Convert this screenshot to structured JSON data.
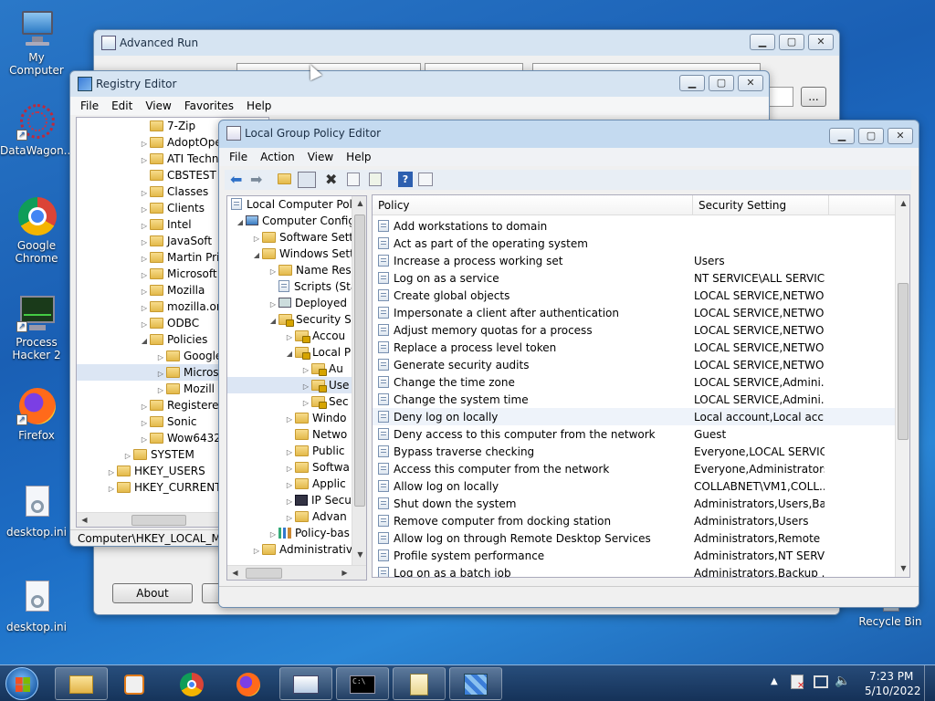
{
  "desktop": {
    "icons": [
      {
        "label": "My Computer"
      },
      {
        "label": "DataWagon..."
      },
      {
        "label": "Google Chrome"
      },
      {
        "label": "Process Hacker 2"
      },
      {
        "label": "Firefox"
      },
      {
        "label": "desktop.ini"
      },
      {
        "label": "desktop.ini"
      },
      {
        "label": "Recycle Bin"
      }
    ]
  },
  "advanced_run": {
    "title": "Advanced Run",
    "about_button": "About",
    "browse_button": "..."
  },
  "registry": {
    "title": "Registry Editor",
    "menu": [
      "File",
      "Edit",
      "View",
      "Favorites",
      "Help"
    ],
    "tree": [
      "7-Zip",
      "AdoptOpe",
      "ATI Techn",
      "CBSTEST",
      "Classes",
      "Clients",
      "Intel",
      "JavaSoft",
      "Martin Pri",
      "Microsoft",
      "Mozilla",
      "mozilla.or",
      "ODBC",
      "Policies",
      "Google",
      "Micros",
      "Mozill",
      "Registered",
      "Sonic",
      "Wow6432N",
      "SYSTEM",
      "HKEY_USERS",
      "HKEY_CURRENT_"
    ],
    "status": "Computer\\HKEY_LOCAL_MA"
  },
  "gpedit": {
    "title": "Local Group Policy Editor",
    "menu": [
      "File",
      "Action",
      "View",
      "Help"
    ],
    "tree": [
      "Local Computer Polic",
      "Computer Config",
      "Software Setti",
      "Windows Sett",
      "Name Res",
      "Scripts (Sta",
      "Deployed",
      "Security Se",
      "Accou",
      "Local P",
      "Au",
      "Use",
      "Sec",
      "Windo",
      "Netwo",
      "Public",
      "Softwa",
      "Applic",
      "IP Secu",
      "Advan",
      "Policy-bas",
      "Administrative"
    ],
    "columns": {
      "policy": "Policy",
      "setting": "Security Setting"
    },
    "rows": [
      {
        "policy": "Add workstations to domain",
        "setting": ""
      },
      {
        "policy": "Act as part of the operating system",
        "setting": ""
      },
      {
        "policy": "Increase a process working set",
        "setting": "Users"
      },
      {
        "policy": "Log on as a service",
        "setting": "NT SERVICE\\ALL SERVIC..."
      },
      {
        "policy": "Create global objects",
        "setting": "LOCAL SERVICE,NETWO..."
      },
      {
        "policy": "Impersonate a client after authentication",
        "setting": "LOCAL SERVICE,NETWO..."
      },
      {
        "policy": "Adjust memory quotas for a process",
        "setting": "LOCAL SERVICE,NETWO..."
      },
      {
        "policy": "Replace a process level token",
        "setting": "LOCAL SERVICE,NETWO..."
      },
      {
        "policy": "Generate security audits",
        "setting": "LOCAL SERVICE,NETWO..."
      },
      {
        "policy": "Change the time zone",
        "setting": "LOCAL SERVICE,Admini..."
      },
      {
        "policy": "Change the system time",
        "setting": "LOCAL SERVICE,Admini..."
      },
      {
        "policy": "Deny log on locally",
        "setting": "Local account,Local acc..."
      },
      {
        "policy": "Deny access to this computer from the network",
        "setting": "Guest"
      },
      {
        "policy": "Bypass traverse checking",
        "setting": "Everyone,LOCAL SERVIC..."
      },
      {
        "policy": "Access this computer from the network",
        "setting": "Everyone,Administrators..."
      },
      {
        "policy": "Allow log on locally",
        "setting": "COLLABNET\\VM1,COLL..."
      },
      {
        "policy": "Shut down the system",
        "setting": "Administrators,Users,Ba..."
      },
      {
        "policy": "Remove computer from docking station",
        "setting": "Administrators,Users"
      },
      {
        "policy": "Allow log on through Remote Desktop Services",
        "setting": "Administrators,Remote ..."
      },
      {
        "policy": "Profile system performance",
        "setting": "Administrators,NT SERVI..."
      },
      {
        "policy": "Log on as a batch job",
        "setting": "Administrators,Backup ..."
      }
    ]
  },
  "taskbar": {
    "time": "7:23 PM",
    "date": "5/10/2022"
  },
  "colors": {
    "accent": "#1a5fb4",
    "selection": "#eef3fa"
  }
}
